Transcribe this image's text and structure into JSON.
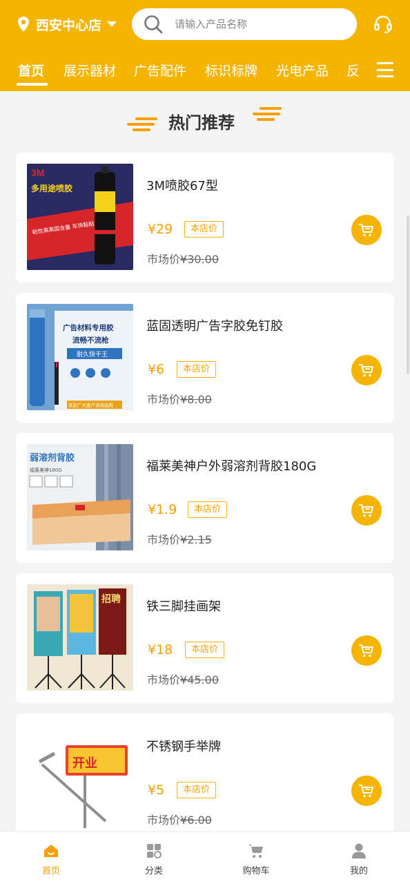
{
  "header": {
    "store_name": "西安中心店",
    "search_placeholder": "请输入产品名称"
  },
  "tabs": [
    {
      "label": "首页",
      "active": true
    },
    {
      "label": "展示器材",
      "active": false
    },
    {
      "label": "广告配件",
      "active": false
    },
    {
      "label": "标识标牌",
      "active": false
    },
    {
      "label": "光电产品",
      "active": false
    },
    {
      "label": "反",
      "active": false
    }
  ],
  "section": {
    "title": "热门推荐"
  },
  "products": [
    {
      "name": "3M喷胶67型",
      "price": "¥29",
      "badge": "本店价",
      "market_label": "市场价",
      "market_price": "¥30.00",
      "image": {
        "headline": "多用途喷胶",
        "brand": "3M",
        "banner": "粘性高高固含量 车饰黏粘专家"
      }
    },
    {
      "name": "蓝固透明广告字胶免钉胶",
      "price": "¥6",
      "badge": "本店价",
      "market_label": "市场价",
      "market_price": "¥8.00",
      "image": {
        "headline": "广告材料专用胶",
        "sub": "流畅不流枪",
        "tag": "耐久快干王",
        "foot": "欢迎广大客户咨询选购"
      }
    },
    {
      "name": "福莱美神户外弱溶剂背胶180G",
      "price": "¥1.9",
      "badge": "本店价",
      "market_label": "市场价",
      "market_price": "¥2.15",
      "image": {
        "headline": "弱溶剂背胶",
        "sub": "福莱美神180G"
      }
    },
    {
      "name": "铁三脚挂画架",
      "price": "¥18",
      "badge": "本店价",
      "market_label": "市场价",
      "market_price": "¥45.00",
      "image": {
        "poster": "招聘"
      }
    },
    {
      "name": "不锈钢手举牌",
      "price": "¥5",
      "badge": "本店价",
      "market_label": "市场价",
      "market_price": "¥6.00",
      "image": {
        "sign": "开业"
      }
    }
  ],
  "bottom_nav": [
    {
      "label": "首页",
      "icon": "home-icon",
      "active": true
    },
    {
      "label": "分类",
      "icon": "category-icon",
      "active": false
    },
    {
      "label": "购物车",
      "icon": "cart-icon",
      "active": false
    },
    {
      "label": "我的",
      "icon": "user-icon",
      "active": false
    }
  ],
  "colors": {
    "brand": "#f5b400",
    "price": "#f5a000",
    "background": "#f4f4f4"
  }
}
